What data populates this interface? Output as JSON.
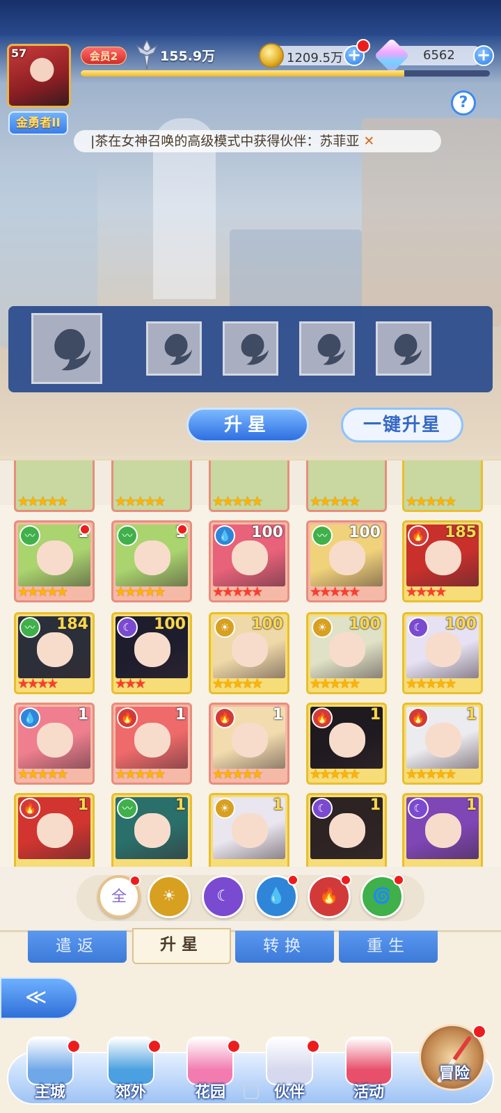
{
  "player": {
    "level": "57",
    "rank_title": "金勇者II",
    "vip": "会员2",
    "power": "155.9万",
    "exp_fraction": 0.79
  },
  "currency": {
    "gold": "1209.5万",
    "gems": "6562"
  },
  "announcement": "|茶在女神召唤的高级模式中获得伙伴：苏菲亚",
  "announcement_close": "✕",
  "help_label": "?",
  "actions": {
    "upgrade": "升星",
    "upgrade_all": "一键升星"
  },
  "colors": {
    "wind": "#3fb04a",
    "water": "#2f86d8",
    "fire": "#d23a3a",
    "light": "#d8a020",
    "dark": "#7a4ad0"
  },
  "heroes": [
    {
      "element": "wind",
      "icon": "wind-icon",
      "level": "1",
      "stars": 5,
      "star_color": "gold",
      "frame": "red",
      "dot": true,
      "hair": "#a9d46e"
    },
    {
      "element": "wind",
      "icon": "wind-icon",
      "level": "1",
      "stars": 5,
      "star_color": "gold",
      "frame": "red",
      "dot": true,
      "hair": "#a9d46e"
    },
    {
      "element": "water",
      "icon": "water-icon",
      "level": "100",
      "stars": 5,
      "star_color": "red",
      "frame": "red",
      "dot": false,
      "hair": "#e8627a"
    },
    {
      "element": "wind",
      "icon": "wind-icon",
      "level": "100",
      "stars": 5,
      "star_color": "red",
      "frame": "red",
      "dot": false,
      "hair": "#f0d27a"
    },
    {
      "element": "fire",
      "icon": "fire-icon",
      "level": "185",
      "stars": 4,
      "star_color": "red",
      "frame": "gold",
      "dot": false,
      "hair": "#c9302c"
    },
    {
      "element": "wind",
      "icon": "wind-icon",
      "level": "184",
      "stars": 4,
      "star_color": "red",
      "frame": "gold",
      "dot": false,
      "hair": "#2b2f3a"
    },
    {
      "element": "dark",
      "icon": "moon-icon",
      "level": "100",
      "stars": 3,
      "star_color": "red",
      "frame": "gold",
      "dot": false,
      "hair": "#1d1d2e"
    },
    {
      "element": "light",
      "icon": "sun-icon",
      "level": "100",
      "stars": 5,
      "star_color": "gold",
      "frame": "gold",
      "dot": false,
      "hair": "#efd9a8"
    },
    {
      "element": "light",
      "icon": "sun-icon",
      "level": "100",
      "stars": 5,
      "star_color": "gold",
      "frame": "gold",
      "dot": false,
      "hair": "#dfe2c6"
    },
    {
      "element": "dark",
      "icon": "moon-icon",
      "level": "100",
      "stars": 5,
      "star_color": "gold",
      "frame": "gold",
      "dot": false,
      "hair": "#e6e2f4"
    },
    {
      "element": "water",
      "icon": "water-icon",
      "level": "1",
      "stars": 5,
      "star_color": "gold",
      "frame": "red",
      "dot": false,
      "hair": "#ef7f8e"
    },
    {
      "element": "fire",
      "icon": "fire-icon",
      "level": "1",
      "stars": 5,
      "star_color": "gold",
      "frame": "red",
      "dot": false,
      "hair": "#ef6a6a"
    },
    {
      "element": "fire",
      "icon": "fire-icon",
      "level": "1",
      "stars": 5,
      "star_color": "gold",
      "frame": "red",
      "dot": false,
      "hair": "#f2dcae"
    },
    {
      "element": "fire",
      "icon": "fire-icon",
      "level": "1",
      "stars": 5,
      "star_color": "gold",
      "frame": "gold",
      "dot": false,
      "hair": "#1e1a1f"
    },
    {
      "element": "fire",
      "icon": "fire-icon",
      "level": "1",
      "stars": 5,
      "star_color": "gold",
      "frame": "gold",
      "dot": false,
      "hair": "#ecebf0"
    },
    {
      "element": "fire",
      "icon": "fire-icon",
      "level": "1",
      "stars": 0,
      "star_color": "gold",
      "frame": "gold",
      "dot": false,
      "hair": "#d2352f"
    },
    {
      "element": "wind",
      "icon": "wind-icon",
      "level": "1",
      "stars": 0,
      "star_color": "gold",
      "frame": "gold",
      "dot": false,
      "hair": "#2a6f6a"
    },
    {
      "element": "light",
      "icon": "sun-icon",
      "level": "1",
      "stars": 0,
      "star_color": "gold",
      "frame": "gold",
      "dot": false,
      "hair": "#e9e6ef"
    },
    {
      "element": "dark",
      "icon": "moon-icon",
      "level": "1",
      "stars": 0,
      "star_color": "gold",
      "frame": "gold",
      "dot": false,
      "hair": "#2c2322"
    },
    {
      "element": "dark",
      "icon": "moon-icon",
      "level": "1",
      "stars": 0,
      "star_color": "gold",
      "frame": "gold",
      "dot": false,
      "hair": "#7f46b6"
    }
  ],
  "filters": [
    {
      "label": "全",
      "icon": "all-icon",
      "color": "#8a6ad0",
      "dot": true
    },
    {
      "label": "☀",
      "icon": "sun-icon",
      "color": "#d8a020",
      "dot": false
    },
    {
      "label": "☾",
      "icon": "moon-icon",
      "color": "#7a4ad0",
      "dot": false
    },
    {
      "label": "💧",
      "icon": "water-icon",
      "color": "#2f86d8",
      "dot": true
    },
    {
      "label": "🔥",
      "icon": "fire-icon",
      "color": "#d23a3a",
      "dot": true
    },
    {
      "label": "🌀",
      "icon": "wind-icon",
      "color": "#3fb04a",
      "dot": true
    }
  ],
  "tabs": [
    "遣返",
    "升星",
    "转换",
    "重生"
  ],
  "active_tab": 1,
  "side_button": "≪",
  "nav": [
    {
      "label": "主城",
      "icon": "castle-icon",
      "color": "#6fa8e8",
      "dot": true
    },
    {
      "label": "郊外",
      "icon": "portal-icon",
      "color": "#4aa0e0",
      "dot": true
    },
    {
      "label": "花园",
      "icon": "heart-garden-icon",
      "color": "#f27cb0",
      "dot": true
    },
    {
      "label": "伙伴",
      "icon": "partner-icon",
      "color": "#d6d9ee",
      "dot": true
    },
    {
      "label": "活动",
      "icon": "gift-icon",
      "color": "#e84f6a",
      "dot": false
    },
    {
      "label": "冒险",
      "icon": "compass-icon",
      "color": "#c2874f",
      "dot": true
    }
  ]
}
